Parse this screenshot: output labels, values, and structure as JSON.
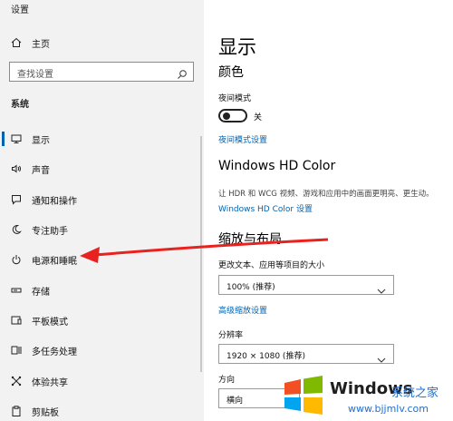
{
  "app_title": "设置",
  "sidebar": {
    "home_label": "主页",
    "search_placeholder": "查找设置",
    "section_label": "系统",
    "items": [
      {
        "label": "显示",
        "icon": "monitor-icon",
        "selected": true
      },
      {
        "label": "声音",
        "icon": "speaker-icon"
      },
      {
        "label": "通知和操作",
        "icon": "notification-icon"
      },
      {
        "label": "专注助手",
        "icon": "moon-icon"
      },
      {
        "label": "电源和睡眠",
        "icon": "power-icon"
      },
      {
        "label": "存储",
        "icon": "storage-icon"
      },
      {
        "label": "平板模式",
        "icon": "tablet-icon"
      },
      {
        "label": "多任务处理",
        "icon": "multitask-icon"
      },
      {
        "label": "体验共享",
        "icon": "share-icon"
      },
      {
        "label": "剪贴板",
        "icon": "clipboard-icon"
      }
    ]
  },
  "main": {
    "title": "显示",
    "color_heading": "颜色",
    "night_mode_label": "夜间模式",
    "night_mode_state": "关",
    "night_mode_settings_link": "夜间模式设置",
    "hd_heading": "Windows HD Color",
    "hd_desc": "让 HDR 和 WCG 视频、游戏和应用中的画面更明亮、更生动。",
    "hd_settings_link": "Windows HD Color 设置",
    "scale_heading": "缩放与布局",
    "scale_label": "更改文本、应用等项目的大小",
    "scale_value": "100% (推荐)",
    "advanced_scale_link": "高级缩放设置",
    "resolution_label": "分辨率",
    "resolution_value": "1920 × 1080 (推荐)",
    "orientation_label": "方向",
    "orientation_value": "横向"
  },
  "watermark": {
    "brand": "Windows",
    "suffix": "系统之家",
    "url": "www.bjjmlv.com"
  },
  "colors": {
    "accent": "#0063b1",
    "sidebar_bg": "#f2f2f2",
    "arrow": "#e8231f"
  }
}
